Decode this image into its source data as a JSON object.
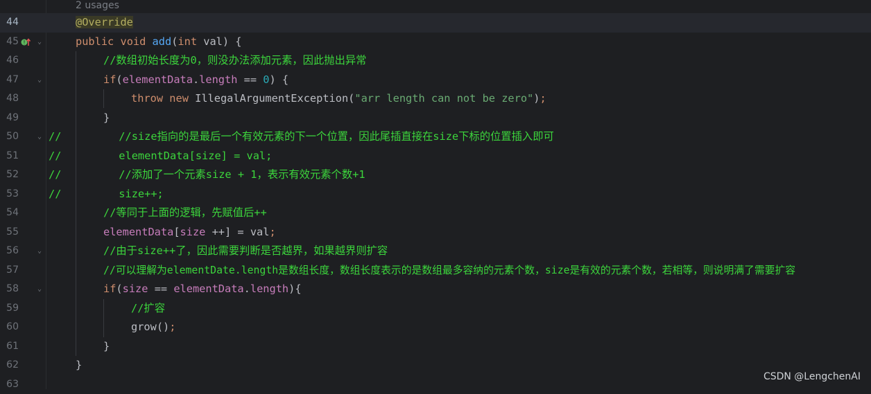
{
  "editor": {
    "usages_hint": "2 usages",
    "watermark": "CSDN @LengchenAI",
    "colors": {
      "background": "#1e1f22",
      "keyword": "#cf8e6d",
      "method": "#56a8f5",
      "field": "#c77dbb",
      "number": "#2aacb8",
      "string": "#6aab73",
      "comment": "#3cd53c",
      "annotation": "#b3ae60"
    },
    "line_numbers": [
      "44",
      "45",
      "46",
      "47",
      "48",
      "49",
      "50",
      "51",
      "52",
      "53",
      "54",
      "55",
      "56",
      "57",
      "58",
      "59",
      "60",
      "61",
      "62",
      "63"
    ],
    "line44": {
      "annotation": "@Override"
    },
    "line45": {
      "public": "public",
      "void": "void",
      "name": "add",
      "open": "(",
      "int": "int",
      "param": " val) {"
    },
    "line46": {
      "comment": "//数组初始长度为0，则没办法添加元素，因此抛出异常"
    },
    "line47": {
      "if": "if",
      "open": "(",
      "field1": "elementData",
      "dot": ".",
      "field2": "length",
      "op": " == ",
      "num": "0",
      "close": ") {"
    },
    "line48": {
      "throw": "throw",
      "new": "new",
      "cls": " IllegalArgumentException(",
      "str": "\"arr length can not be zero\"",
      "close": ")",
      "semi": ";"
    },
    "line49": {
      "text": "}"
    },
    "line50": {
      "comment": "//         //size指向的是最后一个有效元素的下一个位置，因此尾插直接在size下标的位置插入即可"
    },
    "line51": {
      "comment": "//         elementData[size] = val;"
    },
    "line52": {
      "comment": "//         //添加了一个元素size + 1，表示有效元素个数+1"
    },
    "line53": {
      "comment": "//         size++;"
    },
    "line54": {
      "comment": "//等同于上面的逻辑，先赋值后++"
    },
    "line55": {
      "field1": "elementData",
      "bo": "[",
      "field2": "size",
      "rest": " ++] = val",
      "semi": ";"
    },
    "line56": {
      "comment": "//由于size++了，因此需要判断是否越界，如果越界则扩容"
    },
    "line57": {
      "comment": "//可以理解为elementDate.length是数组长度，数组长度表示的是数组最多容纳的元素个数，size是有效的元素个数，若相等，则说明满了需要扩容"
    },
    "line58": {
      "if": "if",
      "open": "(",
      "field1": "size",
      "op": " == ",
      "field2": "elementData",
      "dot": ".",
      "field3": "length",
      "close": "){"
    },
    "line59": {
      "comment": "//扩容"
    },
    "line60": {
      "call": "grow()",
      "semi": ";"
    },
    "line61": {
      "text": "}"
    },
    "line62": {
      "text": "}"
    }
  }
}
